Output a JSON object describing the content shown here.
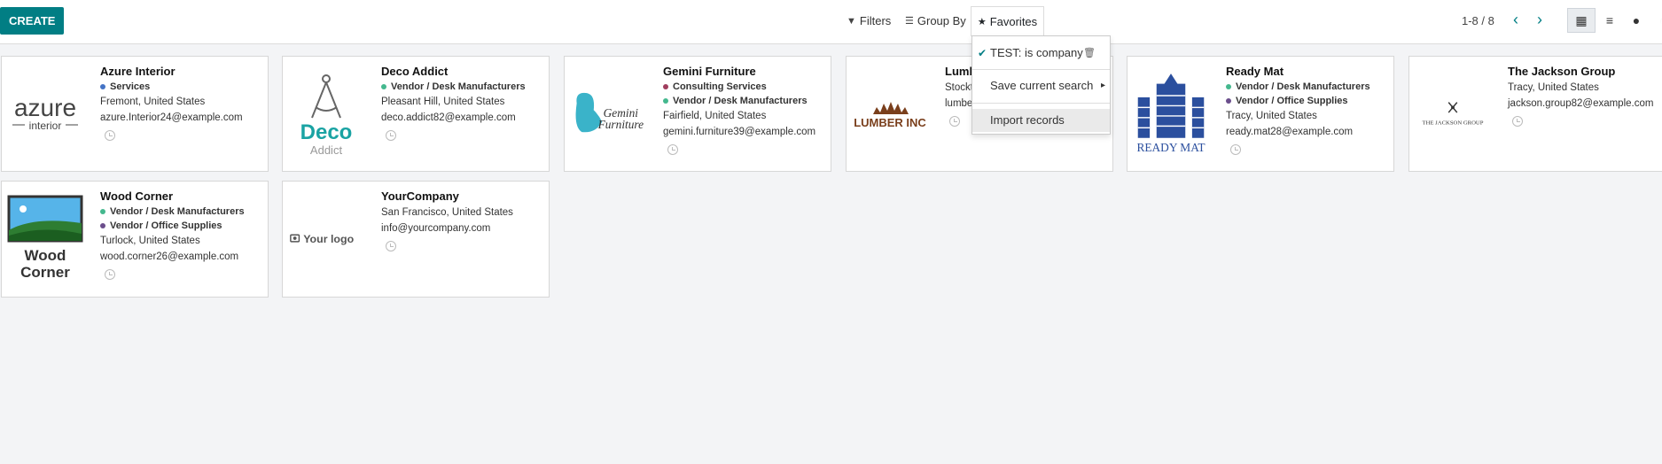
{
  "toolbar": {
    "create_label": "CREATE",
    "filters_label": "Filters",
    "groupby_label": "Group By",
    "favorites_label": "Favorites",
    "pager_text": "1-8 / 8"
  },
  "favorites_menu": {
    "items": [
      "TEST: is company",
      "Save current search",
      "Import records"
    ]
  },
  "colors": {
    "primary": "#017e84",
    "tag_blue": "#4473c5",
    "tag_green": "#44b88e",
    "tag_purple": "#6b4e8c",
    "tag_red": "#a03e5e"
  },
  "cards": [
    {
      "name": "Azure Interior",
      "tags": [
        "Services"
      ],
      "location": "Fremont, United States",
      "email": "azure.Interior24@example.com",
      "logo": [
        "azure",
        "interior"
      ]
    },
    {
      "name": "Deco Addict",
      "tags": [
        "Vendor / Desk Manufacturers"
      ],
      "location": "Pleasant Hill, United States",
      "email": "deco.addict82@example.com",
      "logo": [
        "Deco",
        "Addict"
      ]
    },
    {
      "name": "Gemini Furniture",
      "tags": [
        "Consulting Services",
        "Vendor / Desk Manufacturers"
      ],
      "location": "Fairfield, United States",
      "email": "gemini.furniture39@example.com",
      "logo": [
        "Gemini",
        "Furniture"
      ]
    },
    {
      "name": "Lumb",
      "tags": [],
      "location": "Stockt",
      "email": "lumbe",
      "logo": [
        "LUMBER INC"
      ]
    },
    {
      "name": "Ready Mat",
      "tags": [
        "Vendor / Desk Manufacturers",
        "Vendor / Office Supplies"
      ],
      "location": "Tracy, United States",
      "email": "ready.mat28@example.com",
      "logo": [
        "READY MAT"
      ]
    },
    {
      "name": "The Jackson Group",
      "tags": [],
      "location": "Tracy, United States",
      "email": "jackson.group82@example.com",
      "logo": [
        "THE JACKSON GROUP"
      ]
    },
    {
      "name": "Wood Corner",
      "tags": [
        "Vendor / Desk Manufacturers",
        "Vendor / Office Supplies"
      ],
      "location": "Turlock, United States",
      "email": "wood.corner26@example.com",
      "logo": [
        "Wood",
        "Corner"
      ]
    },
    {
      "name": "YourCompany",
      "tags": [],
      "location": "San Francisco, United States",
      "email": "info@yourcompany.com",
      "logo": [
        "Your logo"
      ]
    }
  ]
}
